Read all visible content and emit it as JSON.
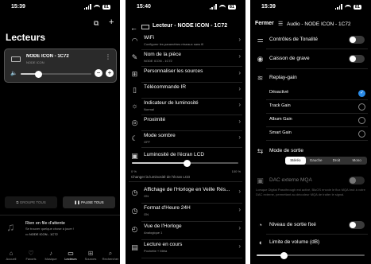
{
  "p1": {
    "time": "15:39",
    "battery": "81",
    "page_title": "Lecteurs",
    "player": {
      "name": "NODE ICON - 1C72",
      "sub": "NODE ICON",
      "volume": 0.25
    },
    "group_all": "GROUPE TOUS",
    "pause_all": "PAUSE TOUS",
    "queue_title": "Rien en file d'attente",
    "queue_sub": "Se trouver quelque chose à jouer !",
    "queue_device": "NODE ICON - 1C72",
    "tabs": [
      {
        "label": "Accueil",
        "icon": "home-icon"
      },
      {
        "label": "Favoris",
        "icon": "heart-icon"
      },
      {
        "label": "Musique",
        "icon": "music-icon"
      },
      {
        "label": "Lecteurs",
        "icon": "speaker-icon"
      },
      {
        "label": "Sources",
        "icon": "sources-icon"
      },
      {
        "label": "Rechercher",
        "icon": "search-icon"
      }
    ]
  },
  "p2": {
    "time": "15:40",
    "battery": "81",
    "header_title": "Lecteur - NODE ICON - 1C72",
    "items": [
      {
        "title": "WiFi",
        "sub": "Configurer les paramètres réseaux sans fil",
        "icon": "wifi-icon"
      },
      {
        "title": "Nom de la pièce",
        "sub": "NODE ICON - 1C72",
        "icon": "edit-icon"
      },
      {
        "title": "Personnaliser les sources",
        "sub": "",
        "icon": "sources-icon"
      },
      {
        "title": "Télécommande IR",
        "sub": "",
        "icon": "remote-icon"
      },
      {
        "title": "Indicateur de luminosité",
        "sub": "Normal",
        "icon": "brightness-icon"
      },
      {
        "title": "Proximité",
        "sub": "",
        "icon": "proximity-icon"
      },
      {
        "title": "Mode sombre",
        "sub": "OFF",
        "icon": "moon-icon"
      }
    ],
    "lcd": {
      "title": "Luminosité de l'écran LCD",
      "min": "0 %",
      "max": "100 %",
      "value": 0.52,
      "desc": "Changer la luminosité de l'écran LCD"
    },
    "items2": [
      {
        "title": "Affichage de l'Horloge en Veille Rés...",
        "sub": "ON",
        "icon": "clock-icon"
      },
      {
        "title": "Format d'Heure 24H",
        "sub": "ON",
        "icon": "clock-icon"
      },
      {
        "title": "Vue de l'Horloge",
        "sub": "Analogique 1",
        "icon": "clock-face-icon"
      },
      {
        "title": "Lecture en cours",
        "sub": "Pochette + Méta",
        "icon": "now-playing-icon"
      }
    ]
  },
  "p3": {
    "time": "15:39",
    "battery": "81",
    "close": "Fermer",
    "header_title": "Audio - NODE ICON - 1C72",
    "tone_controls": "Contrôles de Tonalité",
    "subwoofer": "Caisson de grave",
    "replay_gain": "Replay-gain",
    "rg_options": [
      "Désactivé",
      "Track Gain",
      "Album Gain",
      "Smart Gain"
    ],
    "rg_selected": 0,
    "output_mode": "Mode de sortie",
    "output_options": [
      "Stéréo",
      "Gauche",
      "Droit",
      "Mono"
    ],
    "output_selected": 0,
    "dac_title": "DAC externe MQA",
    "dac_desc": "Lorsque Digital Passthrough est activé, BluOS envoie le flux MQA brut à votre DAC externe, permettant au décodeur MQA de traiter le signal.",
    "fixed_level": "Niveau de sortie fixé",
    "volume_limit": "Limite de volume (dB)",
    "volume_limit_value": 0.25
  }
}
